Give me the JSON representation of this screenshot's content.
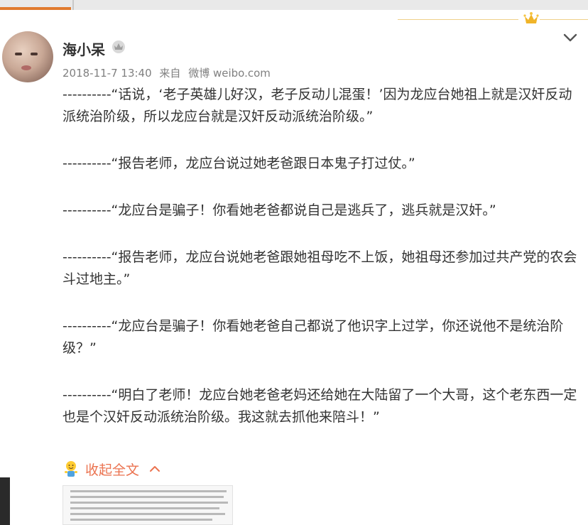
{
  "post": {
    "author": "海小呆",
    "meta": {
      "timestamp": "2018-11-7 13:40",
      "source_prefix": "来自",
      "source_app": "微博 weibo.com"
    },
    "paragraphs": [
      "----------“话说，‘老子英雄儿好汉，老子反动儿混蛋！’因为龙应台她祖上就是汉奸反动派统治阶级，所以龙应台就是汉奸反动派统治阶级。”",
      "----------“报告老师，龙应台说过她老爸跟日本鬼子打过仗。”",
      "----------“龙应台是骗子！你看她老爸都说自己是逃兵了，逃兵就是汉奸。”",
      "----------“报告老师，龙应台说她老爸跟她祖母吃不上饭，她祖母还参加过共产党的农会斗过地主。”",
      "----------“龙应台是骗子！你看她老爸自己都说了他识字上过学，你还说他不是统治阶级？”",
      "----------“明白了老师！龙应台她老爸老妈还给她在大陆留了一个大哥，这个老东西一定也是个汉奸反动派统治阶级。我这就去抓他来陪斗！”"
    ],
    "collapse_label": "收起全文"
  },
  "icons": {
    "member_badge": "crown-icon",
    "verification": "vip-badge-icon",
    "options": "chevron-down-icon",
    "collapse_emoji": "smiley-emoji-icon",
    "collapse_arrow": "chevron-up-icon"
  },
  "colors": {
    "link_orange": "#eb7350",
    "meta_gray": "#808080",
    "gold": "#f0b429"
  }
}
